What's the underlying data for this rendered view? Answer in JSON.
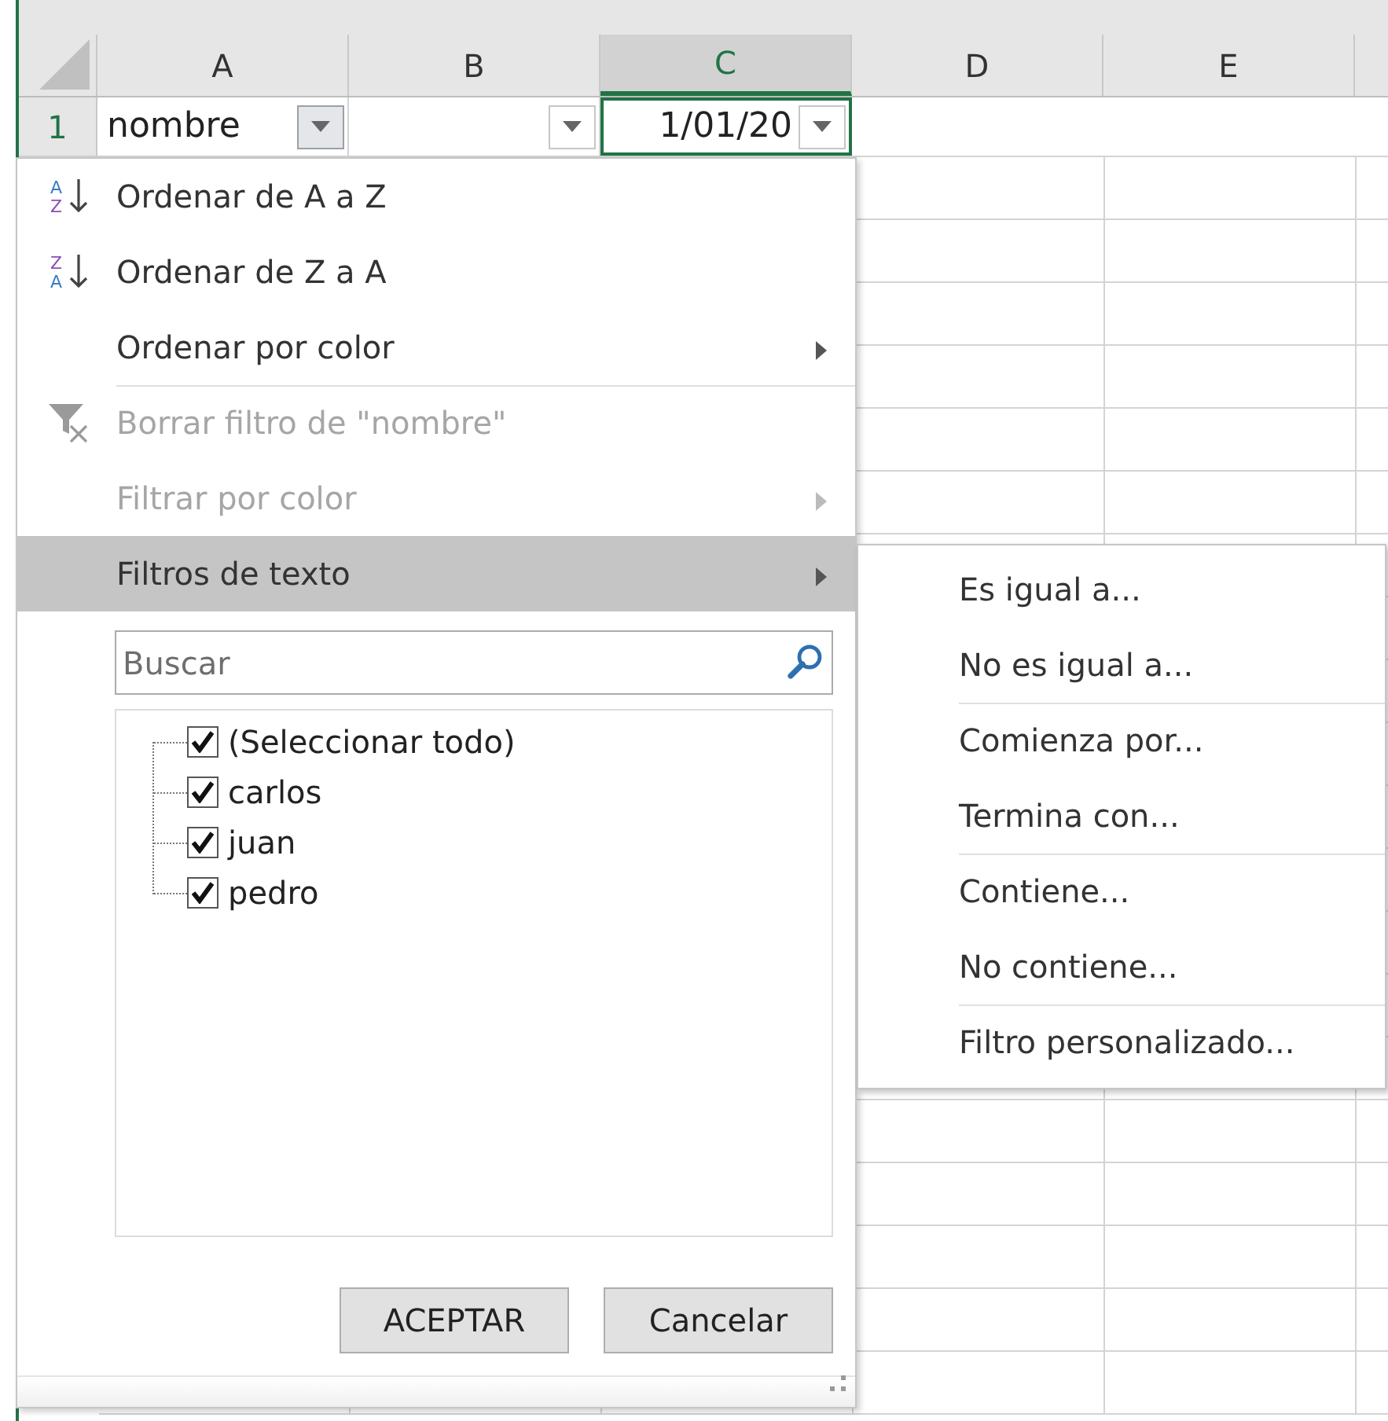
{
  "sheet": {
    "columns": [
      {
        "label": "A",
        "selected": false
      },
      {
        "label": "B",
        "selected": false
      },
      {
        "label": "C",
        "selected": true
      },
      {
        "label": "D",
        "selected": false
      },
      {
        "label": "E",
        "selected": false
      }
    ],
    "row_1": {
      "header": "1",
      "cells": [
        {
          "text": "nombre",
          "kind": "text",
          "selected": false,
          "filter_open": true
        },
        {
          "kind": "text",
          "selected": false,
          "filter_open": false
        },
        {
          "text": "1/01/20",
          "kind": "date",
          "selected": true,
          "filter_open": false
        }
      ]
    }
  },
  "filter_menu": {
    "items": [
      {
        "kind": "sort-ascending",
        "icon_letters": [
          "A",
          "Z"
        ],
        "label": "Ordenar de A a Z",
        "disabled": false,
        "submenu": false,
        "highlighted": false,
        "separator_before": false
      },
      {
        "kind": "sort-descending",
        "icon_letters": [
          "Z",
          "A"
        ],
        "label": "Ordenar de Z a A",
        "disabled": false,
        "submenu": false,
        "highlighted": false,
        "separator_before": false
      },
      {
        "kind": "plain",
        "label": "Ordenar por color",
        "disabled": false,
        "submenu": true,
        "highlighted": false,
        "separator_before": false
      },
      {
        "kind": "clear-filter",
        "label": "Borrar filtro de \"nombre\"",
        "disabled": true,
        "submenu": false,
        "highlighted": false,
        "separator_before": true
      },
      {
        "kind": "plain",
        "label": "Filtrar por color",
        "disabled": true,
        "submenu": true,
        "highlighted": false,
        "separator_before": false
      },
      {
        "kind": "plain",
        "label": "Filtros de texto",
        "disabled": false,
        "submenu": true,
        "highlighted": true,
        "separator_before": false
      }
    ],
    "search": {
      "placeholder": "Buscar"
    },
    "values": [
      {
        "label": "(Seleccionar todo)",
        "checked": true
      },
      {
        "label": "carlos",
        "checked": true
      },
      {
        "label": "juan",
        "checked": true
      },
      {
        "label": "pedro",
        "checked": true
      }
    ],
    "buttons": [
      {
        "label": "ACEPTAR"
      },
      {
        "label": "Cancelar"
      }
    ]
  },
  "text_filters_submenu": {
    "items": [
      {
        "label": "Es igual a...",
        "separator_before": false
      },
      {
        "label": "No es igual a...",
        "separator_before": false
      },
      {
        "label": "Comienza por...",
        "separator_before": true
      },
      {
        "label": "Termina con...",
        "separator_before": false
      },
      {
        "label": "Contiene...",
        "separator_before": true
      },
      {
        "label": "No contiene...",
        "separator_before": false
      },
      {
        "label": "Filtro personalizado...",
        "separator_before": true
      }
    ]
  }
}
